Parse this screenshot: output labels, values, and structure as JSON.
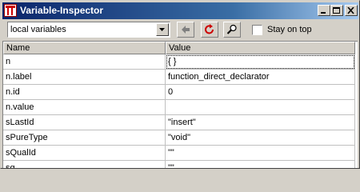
{
  "window": {
    "title": "Variable-Inspector"
  },
  "toolbar": {
    "scope_select_value": "local variables",
    "stay_on_top_label": "Stay on top",
    "stay_on_top_checked": false,
    "back_icon": "left-arrow-icon",
    "refresh_icon": "refresh-icon",
    "find_icon": "magnifier-icon"
  },
  "table": {
    "columns": [
      "Name",
      "Value"
    ],
    "rows": [
      {
        "name": "n",
        "value": "{ }"
      },
      {
        "name": "n.label",
        "value": "function_direct_declarator"
      },
      {
        "name": "n.id",
        "value": "0"
      },
      {
        "name": "n.value",
        "value": ""
      },
      {
        "name": "sLastId",
        "value": "\"insert\""
      },
      {
        "name": "sPureType",
        "value": "\"void\""
      },
      {
        "name": "sQualId",
        "value": "\"\""
      },
      {
        "name": "sq",
        "value": "\"\""
      }
    ]
  },
  "colors": {
    "titlebar_start": "#0a246a",
    "titlebar_end": "#a6caf0",
    "refresh_icon": "#cc0000",
    "face": "#d4d0c8"
  }
}
